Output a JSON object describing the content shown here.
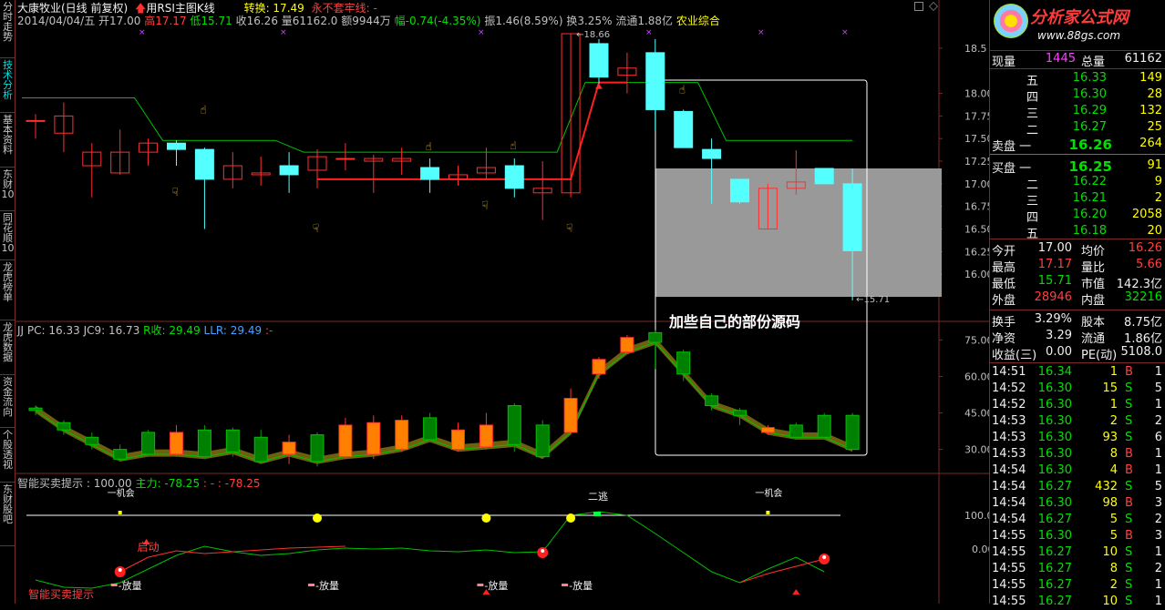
{
  "left_tabs": [
    {
      "label": "分时走势",
      "active": false
    },
    {
      "label": "技术分析",
      "active": true
    },
    {
      "label": "基本资料",
      "active": false
    },
    {
      "label": "东财10",
      "active": false
    },
    {
      "label": "同花顺10",
      "active": false
    },
    {
      "label": "龙虎榜单",
      "active": false
    },
    {
      "label": "龙虎数据",
      "active": false
    },
    {
      "label": "资金流向",
      "active": false
    },
    {
      "label": "个股透视",
      "active": false
    },
    {
      "label": "东财股吧",
      "active": false
    }
  ],
  "header": {
    "stock_name": "大康牧业(日线 前复权)",
    "formula_label": "用RSI主图K线",
    "zhuanhuan": "转换: 17.49",
    "yongbu": "永不套牢线: -",
    "date_open": "2014/04/04/五 开17.00",
    "high": "高17.17",
    "low": "低15.71",
    "close": "收16.26",
    "volume": "量61162.0",
    "amount": "额9944万",
    "change": "幅-0.74(-4.35%)",
    "amplitude": "振1.46(8.59%)",
    "turnover": "换3.25%",
    "float": "流通1.88亿",
    "sector": "农业综合"
  },
  "main_axis": [
    "18.5",
    "18.00",
    "17.75",
    "17.50",
    "17.25",
    "17.00",
    "16.75",
    "16.50",
    "16.25",
    "16.00"
  ],
  "main_labels": {
    "high_mark": "18.66",
    "low_mark": "15.71"
  },
  "annotation": "加些自己的部份源码",
  "sub1_header": {
    "name": "JJ",
    "pc": "PC: 16.33",
    "jc9": "JC9: 16.73",
    "rshou": "R收: 29.49",
    "llr": "LLR: 29.49",
    "dash": ":-"
  },
  "sub1_axis": [
    "75.00",
    "60.00",
    "45.00",
    "30.00"
  ],
  "sub2_header": {
    "name": "智能买卖提示",
    "val": ": 100.00",
    "zhuli": "主力: -78.25",
    "dash": ": -",
    "val2": ": -78.25"
  },
  "sub2_axis": [
    "100.00",
    "0.00"
  ],
  "sub2_labels": {
    "qidong": "启动",
    "fangliang": "放量",
    "tao": "二逃",
    "buy_hint": "智能买卖提示",
    "yiji": "一机会"
  },
  "quote": {
    "logo_brand": "分析家公式网",
    "logo_url": "www.88gs.com",
    "xianliang_label": "现量",
    "xianliang": "1445",
    "zongliang_label": "总量",
    "zongliang": "61162",
    "asks": [
      {
        "label": "五",
        "price": "16.33",
        "vol": "149"
      },
      {
        "label": "四",
        "price": "16.30",
        "vol": "28"
      },
      {
        "label": "三",
        "price": "16.29",
        "vol": "132"
      },
      {
        "label": "二",
        "price": "16.27",
        "vol": "25"
      }
    ],
    "ask1": {
      "label": "卖盘 一",
      "price": "16.26",
      "vol": "264"
    },
    "bid1": {
      "label": "买盘 一",
      "price": "16.25",
      "vol": "91"
    },
    "bids": [
      {
        "label": "二",
        "price": "16.22",
        "vol": "9"
      },
      {
        "label": "三",
        "price": "16.21",
        "vol": "2"
      },
      {
        "label": "四",
        "price": "16.20",
        "vol": "2058"
      },
      {
        "label": "五",
        "price": "16.18",
        "vol": "20"
      }
    ],
    "stats": [
      {
        "l1": "今开",
        "v1": "17.00",
        "c1": "wht",
        "l2": "均价",
        "v2": "16.26",
        "c2": "red"
      },
      {
        "l1": "最高",
        "v1": "17.17",
        "c1": "red",
        "l2": "量比",
        "v2": "5.66",
        "c2": "red"
      },
      {
        "l1": "最低",
        "v1": "15.71",
        "c1": "grn",
        "l2": "市值",
        "v2": "142.3亿",
        "c2": "wht"
      },
      {
        "l1": "外盘",
        "v1": "28946",
        "c1": "red",
        "l2": "内盘",
        "v2": "32216",
        "c2": "grn"
      },
      {
        "l1": "换手",
        "v1": "3.29%",
        "c1": "wht",
        "l2": "股本",
        "v2": "8.75亿",
        "c2": "wht"
      },
      {
        "l1": "净资",
        "v1": "3.29",
        "c1": "wht",
        "l2": "流通",
        "v2": "1.86亿",
        "c2": "wht"
      },
      {
        "l1": "收益(三)",
        "v1": "0.00",
        "c1": "wht",
        "l2": "PE(动)",
        "v2": "5108.0",
        "c2": "wht"
      }
    ],
    "ticks": [
      {
        "t": "14:51",
        "p": "16.34",
        "v": "1",
        "s": "B",
        "n": "1"
      },
      {
        "t": "14:52",
        "p": "16.30",
        "v": "15",
        "s": "S",
        "n": "5"
      },
      {
        "t": "14:52",
        "p": "16.30",
        "v": "1",
        "s": "S",
        "n": "1"
      },
      {
        "t": "14:53",
        "p": "16.30",
        "v": "2",
        "s": "S",
        "n": "2"
      },
      {
        "t": "14:53",
        "p": "16.30",
        "v": "93",
        "s": "S",
        "n": "6"
      },
      {
        "t": "14:53",
        "p": "16.30",
        "v": "8",
        "s": "B",
        "n": "1"
      },
      {
        "t": "14:54",
        "p": "16.30",
        "v": "4",
        "s": "B",
        "n": "1"
      },
      {
        "t": "14:54",
        "p": "16.27",
        "v": "432",
        "s": "S",
        "n": "5"
      },
      {
        "t": "14:54",
        "p": "16.30",
        "v": "98",
        "s": "B",
        "n": "3"
      },
      {
        "t": "14:54",
        "p": "16.27",
        "v": "5",
        "s": "S",
        "n": "2"
      },
      {
        "t": "14:55",
        "p": "16.30",
        "v": "5",
        "s": "B",
        "n": "3"
      },
      {
        "t": "14:55",
        "p": "16.27",
        "v": "10",
        "s": "S",
        "n": "1"
      },
      {
        "t": "14:55",
        "p": "16.27",
        "v": "8",
        "s": "S",
        "n": "2"
      },
      {
        "t": "14:55",
        "p": "16.27",
        "v": "2",
        "s": "S",
        "n": "1"
      },
      {
        "t": "14:55",
        "p": "16.27",
        "v": "10",
        "s": "S",
        "n": "1"
      }
    ]
  },
  "candles": [
    {
      "o": 17.7,
      "c": 17.7,
      "h": 17.77,
      "l": 17.5
    },
    {
      "o": 17.56,
      "c": 17.75,
      "h": 17.9,
      "l": 17.35
    },
    {
      "o": 17.2,
      "c": 17.35,
      "h": 17.45,
      "l": 16.85
    },
    {
      "o": 17.12,
      "c": 17.35,
      "h": 17.6,
      "l": 17.1
    },
    {
      "o": 17.35,
      "c": 17.45,
      "h": 17.5,
      "l": 17.2
    },
    {
      "o": 17.45,
      "c": 17.38,
      "h": 17.48,
      "l": 17.2
    },
    {
      "o": 17.38,
      "c": 17.05,
      "h": 17.4,
      "l": 16.5
    },
    {
      "o": 17.05,
      "c": 17.2,
      "h": 17.35,
      "l": 16.95
    },
    {
      "o": 17.1,
      "c": 17.12,
      "h": 17.3,
      "l": 16.98
    },
    {
      "o": 17.2,
      "c": 17.1,
      "h": 17.35,
      "l": 16.9
    },
    {
      "o": 17.15,
      "c": 17.3,
      "h": 17.38,
      "l": 16.95
    },
    {
      "o": 17.28,
      "c": 17.28,
      "h": 17.45,
      "l": 17.15
    },
    {
      "o": 17.25,
      "c": 17.28,
      "h": 17.32,
      "l": 16.9
    },
    {
      "o": 17.25,
      "c": 17.28,
      "h": 17.4,
      "l": 17.1
    },
    {
      "o": 17.18,
      "c": 17.05,
      "h": 17.28,
      "l": 16.9
    },
    {
      "o": 17.05,
      "c": 17.1,
      "h": 17.2,
      "l": 16.98
    },
    {
      "o": 17.12,
      "c": 17.18,
      "h": 17.4,
      "l": 17.05
    },
    {
      "o": 17.2,
      "c": 16.95,
      "h": 17.28,
      "l": 16.85
    },
    {
      "o": 16.9,
      "c": 16.95,
      "h": 17.25,
      "l": 16.6
    },
    {
      "o": 16.9,
      "c": 18.66,
      "h": 18.66,
      "l": 16.85
    },
    {
      "o": 18.55,
      "c": 18.18,
      "h": 18.6,
      "l": 18.05
    },
    {
      "o": 18.2,
      "c": 18.28,
      "h": 18.45,
      "l": 18.0
    },
    {
      "o": 18.45,
      "c": 17.82,
      "h": 18.6,
      "l": 17.58
    },
    {
      "o": 17.8,
      "c": 17.4,
      "h": 17.82,
      "l": 17.4
    },
    {
      "o": 17.38,
      "c": 17.28,
      "h": 17.5,
      "l": 16.78
    },
    {
      "o": 17.05,
      "c": 16.8,
      "h": 17.05,
      "l": 16.78
    },
    {
      "o": 16.5,
      "c": 16.95,
      "h": 17.0,
      "l": 16.5
    },
    {
      "o": 16.95,
      "c": 17.02,
      "h": 17.37,
      "l": 16.88
    },
    {
      "o": 17.17,
      "c": 17.0,
      "h": 17.17,
      "l": 17.0
    },
    {
      "o": 17.0,
      "c": 16.26,
      "h": 17.17,
      "l": 15.71
    }
  ],
  "green_line": [
    17.95,
    17.95,
    17.95,
    17.95,
    17.95,
    17.48,
    17.48,
    17.48,
    17.48,
    17.48,
    17.35,
    17.35,
    17.35,
    17.35,
    17.35,
    17.35,
    17.35,
    17.35,
    17.35,
    17.35,
    18.12,
    18.12,
    18.12,
    18.12,
    18.12,
    17.48,
    17.48,
    17.48,
    17.48,
    17.48
  ],
  "red_line": [
    null,
    null,
    null,
    null,
    null,
    null,
    null,
    null,
    null,
    null,
    17.05,
    17.05,
    17.05,
    17.05,
    17.05,
    17.05,
    17.05,
    17.05,
    17.05,
    17.05,
    18.12,
    18.12,
    null,
    null,
    null,
    null,
    null,
    null,
    null,
    null
  ],
  "sub1_candles": [
    {
      "o": 47,
      "c": 46,
      "h": 48,
      "l": 44
    },
    {
      "o": 41,
      "c": 38,
      "h": 42,
      "l": 36
    },
    {
      "o": 35,
      "c": 32,
      "h": 37,
      "l": 30
    },
    {
      "o": 30,
      "c": 26,
      "h": 32,
      "l": 25
    },
    {
      "o": 37,
      "c": 28,
      "h": 38,
      "l": 27
    },
    {
      "o": 28,
      "c": 37,
      "h": 40,
      "l": 27
    },
    {
      "o": 38,
      "c": 27,
      "h": 40,
      "l": 26
    },
    {
      "o": 38,
      "c": 29,
      "h": 39,
      "l": 27
    },
    {
      "o": 35,
      "c": 25,
      "h": 38,
      "l": 24
    },
    {
      "o": 28,
      "c": 33,
      "h": 36,
      "l": 24
    },
    {
      "o": 36,
      "c": 25,
      "h": 37,
      "l": 23
    },
    {
      "o": 27,
      "c": 40,
      "h": 43,
      "l": 26
    },
    {
      "o": 28,
      "c": 41,
      "h": 44,
      "l": 26
    },
    {
      "o": 30,
      "c": 42,
      "h": 44,
      "l": 29
    },
    {
      "o": 43,
      "c": 34,
      "h": 45,
      "l": 33
    },
    {
      "o": 30,
      "c": 38,
      "h": 41,
      "l": 29
    },
    {
      "o": 31,
      "c": 40,
      "h": 45,
      "l": 30
    },
    {
      "o": 48,
      "c": 32,
      "h": 49,
      "l": 29
    },
    {
      "o": 40,
      "c": 27,
      "h": 42,
      "l": 27
    },
    {
      "o": 37,
      "c": 51,
      "h": 55,
      "l": 36
    },
    {
      "o": 61,
      "c": 67,
      "h": 68,
      "l": 59
    },
    {
      "o": 70,
      "c": 76,
      "h": 77,
      "l": 69
    },
    {
      "o": 78,
      "c": 74,
      "h": 79,
      "l": 63
    },
    {
      "o": 70,
      "c": 61,
      "h": 71,
      "l": 58
    },
    {
      "o": 52,
      "c": 48,
      "h": 53,
      "l": 46
    },
    {
      "o": 46,
      "c": 44,
      "h": 47,
      "l": 40
    },
    {
      "o": 37,
      "c": 39,
      "h": 40,
      "l": 36
    },
    {
      "o": 40,
      "c": 35,
      "h": 41,
      "l": 34
    },
    {
      "o": 44,
      "c": 35,
      "h": 45,
      "l": 34
    },
    {
      "o": 44,
      "c": 30,
      "h": 45,
      "l": 30
    }
  ]
}
